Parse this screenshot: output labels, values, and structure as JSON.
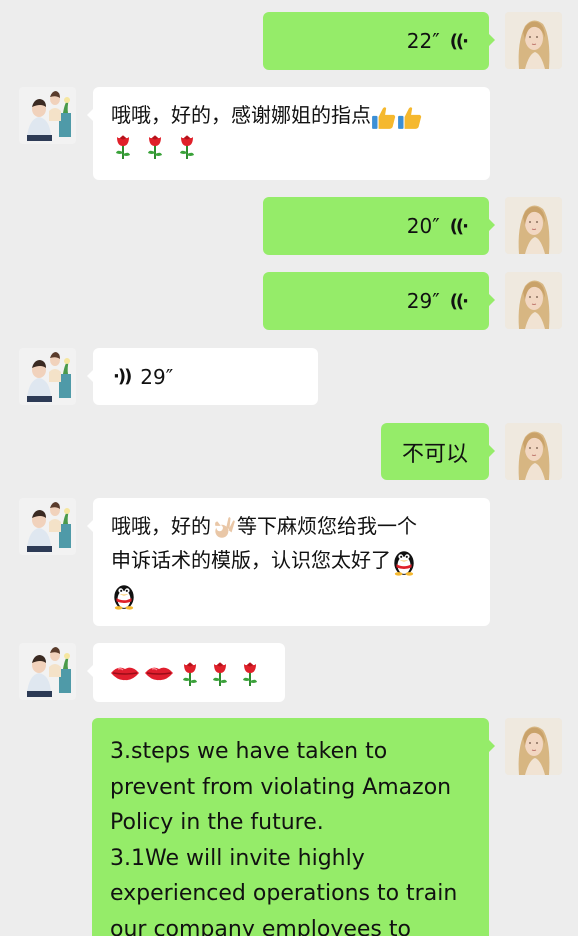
{
  "messages": {
    "m1": {
      "duration": "22″"
    },
    "m2": {
      "text": "哦哦，好的，感谢娜姐的指点"
    },
    "m3": {
      "duration": "20″"
    },
    "m4": {
      "duration": "29″"
    },
    "m5": {
      "duration": "29″"
    },
    "m6": {
      "text": "不可以"
    },
    "m7": {
      "line1": "哦哦，好的",
      "line1b": "等下麻烦您给我一个",
      "line2": "申诉话术的模版，认识您太好了"
    },
    "m9": {
      "lines": [
        "3.steps we have taken to",
        "prevent from violating Amazon",
        "Policy in the future.",
        "3.1We will invite highly",
        "experienced operations to train",
        "our company employees to"
      ]
    }
  },
  "colors": {
    "background": "#ededed",
    "sent_bubble": "#95ec69",
    "received_bubble": "#ffffff"
  },
  "icons": {
    "voice": "voice-wave-icon",
    "thumbs": "thumbs-up-icon",
    "rose": "rose-icon",
    "ok": "ok-hand-icon",
    "penguin": "penguin-icon",
    "lips": "lips-icon"
  }
}
